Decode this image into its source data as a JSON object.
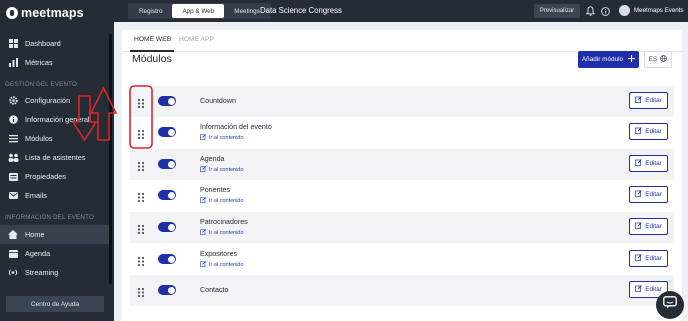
{
  "brand": {
    "logo_text": "meetmaps"
  },
  "sidebar": {
    "items_top": [
      {
        "label": "Dashboard",
        "icon": "dashboard-icon"
      },
      {
        "label": "Métricas",
        "icon": "chart-icon"
      }
    ],
    "section_event_management": "GESTIÓN DEL EVENTO",
    "items_management": [
      {
        "label": "Configuración",
        "icon": "gear-icon"
      },
      {
        "label": "Información general",
        "icon": "info-icon"
      },
      {
        "label": "Módulos",
        "icon": "list-icon"
      },
      {
        "label": "Lista de asistentes",
        "icon": "users-icon"
      },
      {
        "label": "Propiedades",
        "icon": "folder-icon"
      },
      {
        "label": "Emails",
        "icon": "mail-icon"
      }
    ],
    "section_event_info": "INFORMACIÓN DEL EVENTO",
    "items_info": [
      {
        "label": "Home",
        "icon": "home-icon",
        "active": true
      },
      {
        "label": "Agenda",
        "icon": "calendar-icon"
      },
      {
        "label": "Streaming",
        "icon": "broadcast-icon"
      }
    ],
    "help_label": "Centro de Ayuda"
  },
  "topbar": {
    "tabs": [
      {
        "label": "Registro",
        "active": false
      },
      {
        "label": "App & Web",
        "active": true
      },
      {
        "label": "Meetings",
        "active": false
      }
    ],
    "event_title": "Data Science Congress",
    "preview_label": "Previsualizar",
    "user_name": "Meetmaps Events"
  },
  "main": {
    "subtabs": [
      {
        "label": "HOME WEB",
        "active": true
      },
      {
        "label": "HOME APP",
        "active": false
      }
    ],
    "title": "Módulos",
    "add_module_label": "Añadir módulo",
    "language_label": "ES",
    "goto_label": "Ir al contenido",
    "edit_label": "Editar",
    "modules": [
      {
        "name": "Countdown",
        "has_link": false,
        "enabled": true
      },
      {
        "name": "Información del evento",
        "has_link": true,
        "enabled": true
      },
      {
        "name": "Agenda",
        "has_link": true,
        "enabled": true
      },
      {
        "name": "Ponentes",
        "has_link": true,
        "enabled": true
      },
      {
        "name": "Patrocinadores",
        "has_link": true,
        "enabled": true
      },
      {
        "name": "Expositores",
        "has_link": true,
        "enabled": true
      },
      {
        "name": "Contacto",
        "has_link": false,
        "enabled": true
      }
    ]
  },
  "colors": {
    "sidebar_bg": "#252c36",
    "accent_blue": "#1f2fa9",
    "annotation_red": "#d9252b"
  }
}
